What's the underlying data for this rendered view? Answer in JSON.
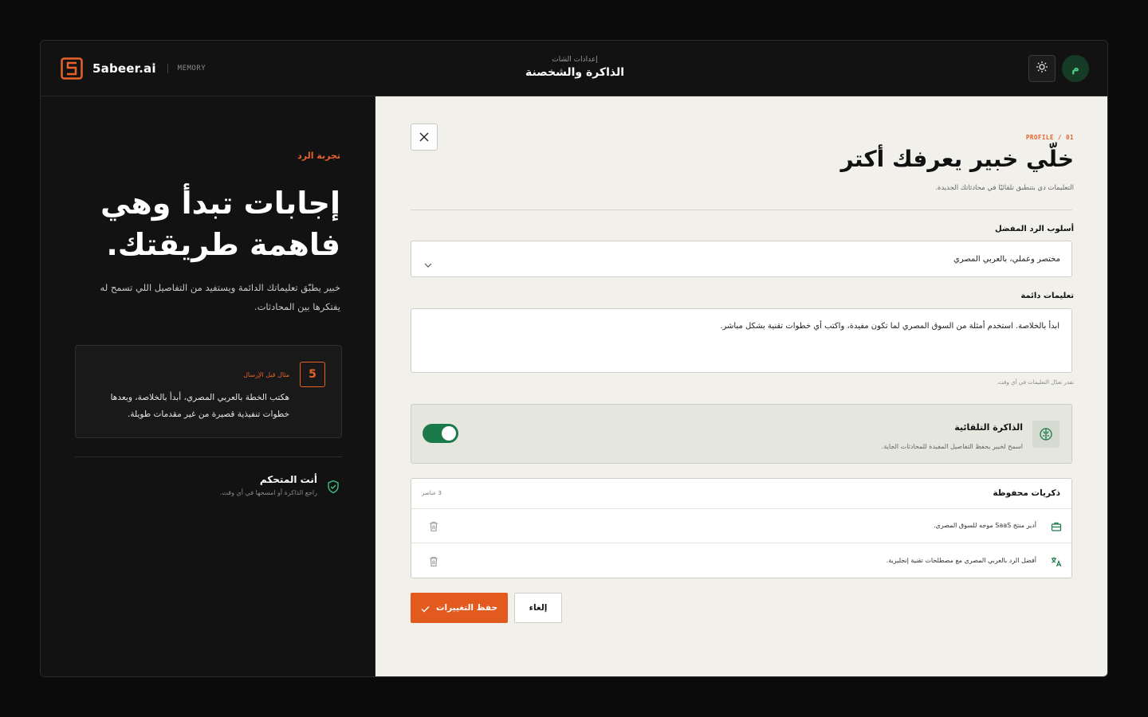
{
  "brand": {
    "name": "5abeer.ai",
    "tag": "MEMORY",
    "logo_icon": "5-logo-icon"
  },
  "header": {
    "subtitle": "إعدادات الشات",
    "title": "الذاكرة والشخصنة",
    "theme_icon": "sun-icon",
    "avatar_initial": "م"
  },
  "left_panel": {
    "tag": "تجربة الرد",
    "hero": "إجابات تبدأ وهي فاهمة طريقتك.",
    "description": "خبير يطبّق تعليماتك الدائمة ويستفيد من التفاصيل اللي تسمح له يفتكرها بين المحادثات.",
    "example": {
      "badge": "5",
      "label": "مثال قبل الإرسال",
      "text": "هكتب الخطة بالعربي المصري، أبدأ بالخلاصة، وبعدها خطوات تنفيذية قصيرة من غير مقدمات طويلة."
    },
    "control": {
      "title": "أنت المتحكم",
      "subtitle": "راجع الذاكرة أو امسحها في أي وقت.",
      "icon": "shield-check-icon"
    }
  },
  "main": {
    "profile_tag": "PROFILE / 01",
    "title": "خلّي خبير يعرفك أكتر",
    "subtitle": "التعليمات دي بتنطبق تلقائيًا في محادثاتك الجديدة.",
    "style_field": {
      "label": "أسلوب الرد المفضل",
      "value": "مختصر وعملي، بالعربي المصري"
    },
    "instructions_field": {
      "label": "تعليمات دائمة",
      "value": "ابدأ بالخلاصة. استخدم أمثلة من السوق المصري لما تكون مفيدة، واكتب أي خطوات تقنية بشكل مباشر.",
      "hint": "تقدر تعدّل التعليمات في أي وقت."
    },
    "auto_memory": {
      "title": "الذاكرة التلقائية",
      "subtitle": "اسمح لخبير يحفظ التفاصيل المفيدة للمحادثات الجاية.",
      "enabled": true,
      "icon": "brain-icon"
    },
    "saved": {
      "title": "ذكريات محفوظة",
      "count": "3 عناصر",
      "items": [
        {
          "text": "أدير منتج SaaS موجه للسوق المصري.",
          "icon": "briefcase-icon"
        },
        {
          "text": "أفضل الرد بالعربي المصري مع مصطلحات تقنية إنجليزية.",
          "icon": "translate-icon"
        }
      ]
    },
    "save_label": "حفظ التغييرات",
    "cancel_label": "إلغاء"
  },
  "colors": {
    "accent": "#e35a1e",
    "toggle_on": "#1b7a4a",
    "dark_bg": "#121212",
    "light_bg": "#f1f0eb"
  }
}
